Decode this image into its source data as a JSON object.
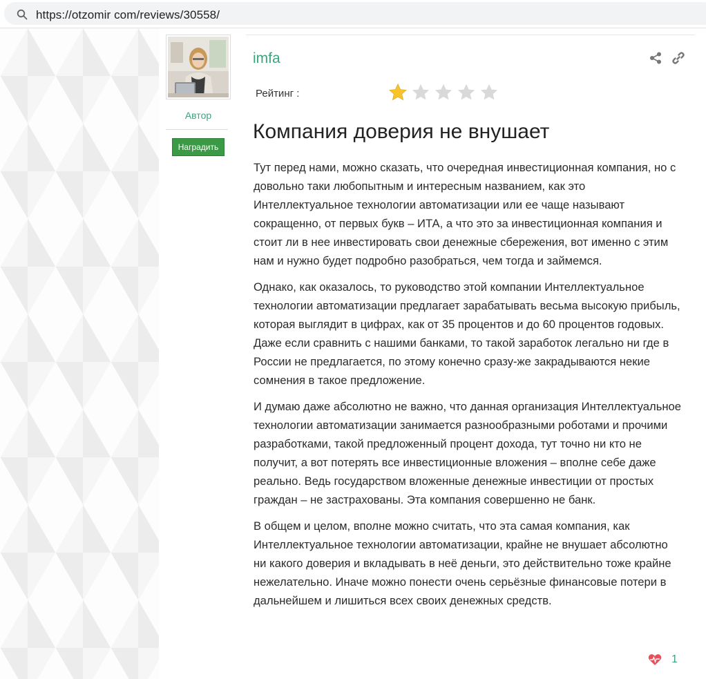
{
  "browser": {
    "url": "https://otzomir com/reviews/30558/"
  },
  "author": {
    "label": "Автор",
    "reward_button": "Наградить"
  },
  "review": {
    "username": "imfa",
    "rating_label": "Рейтинг :",
    "rating": 1,
    "rating_max": 5,
    "title": "Компания доверия не внушает",
    "paragraphs": [
      "Тут перед нами, можно сказать, что очередная инвестиционная компания, но с довольно таки любопытным и интересным названием, как это Интеллектуальное технологии автоматизации или ее чаще называют сокращенно, от первых букв – ИТА, а что это за инвестиционная компания и стоит ли в нее инвестировать свои денежные сбережения, вот именно с этим нам и нужно будет подробно разобраться, чем тогда и займемся.",
      "Однако, как оказалось, то руководство этой компании Интеллектуальное технологии автоматизации предлагает зарабатывать весьма высокую прибыль, которая выглядит в цифрах, как от 35 процентов и до 60 процентов годовых. Даже если сравнить с нашими банками, то такой заработок легально ни где в России не предлагается, по этому конечно сразу-же закрадываются некие сомнения в такое предложение.",
      "И думаю даже абсолютно не важно, что данная организация Интеллектуальное технологии автоматизации занимается разнообразными роботами и прочими разработками, такой предложенный процент дохода, тут точно ни кто не получит, а вот потерять все инвестиционные вложения – вполне себе даже реально. Ведь государством вложенные денежные инвестиции от простых граждан – не застрахованы. Эта компания совершенно не банк.",
      "В общем и целом, вполне можно считать, что эта самая компания, как Интеллектуальное технологии автоматизации, крайне не внушает абсолютно ни какого доверия и вкладывать в неё деньги, это действительно тоже крайне нежелательно. Иначе можно понести очень серьёзные финансовые потери в дальнейшем и лишиться всех своих денежных средств."
    ],
    "likes": "1"
  },
  "colors": {
    "accent_green": "#3aa57d",
    "button_green": "#3b9a45",
    "star_filled": "#f7c52b",
    "star_empty": "#d9d9d9",
    "heart": "#e8505b"
  },
  "icons": {
    "search": "search-icon",
    "share": "share-icon",
    "link": "link-icon",
    "heart": "heart-icon"
  }
}
